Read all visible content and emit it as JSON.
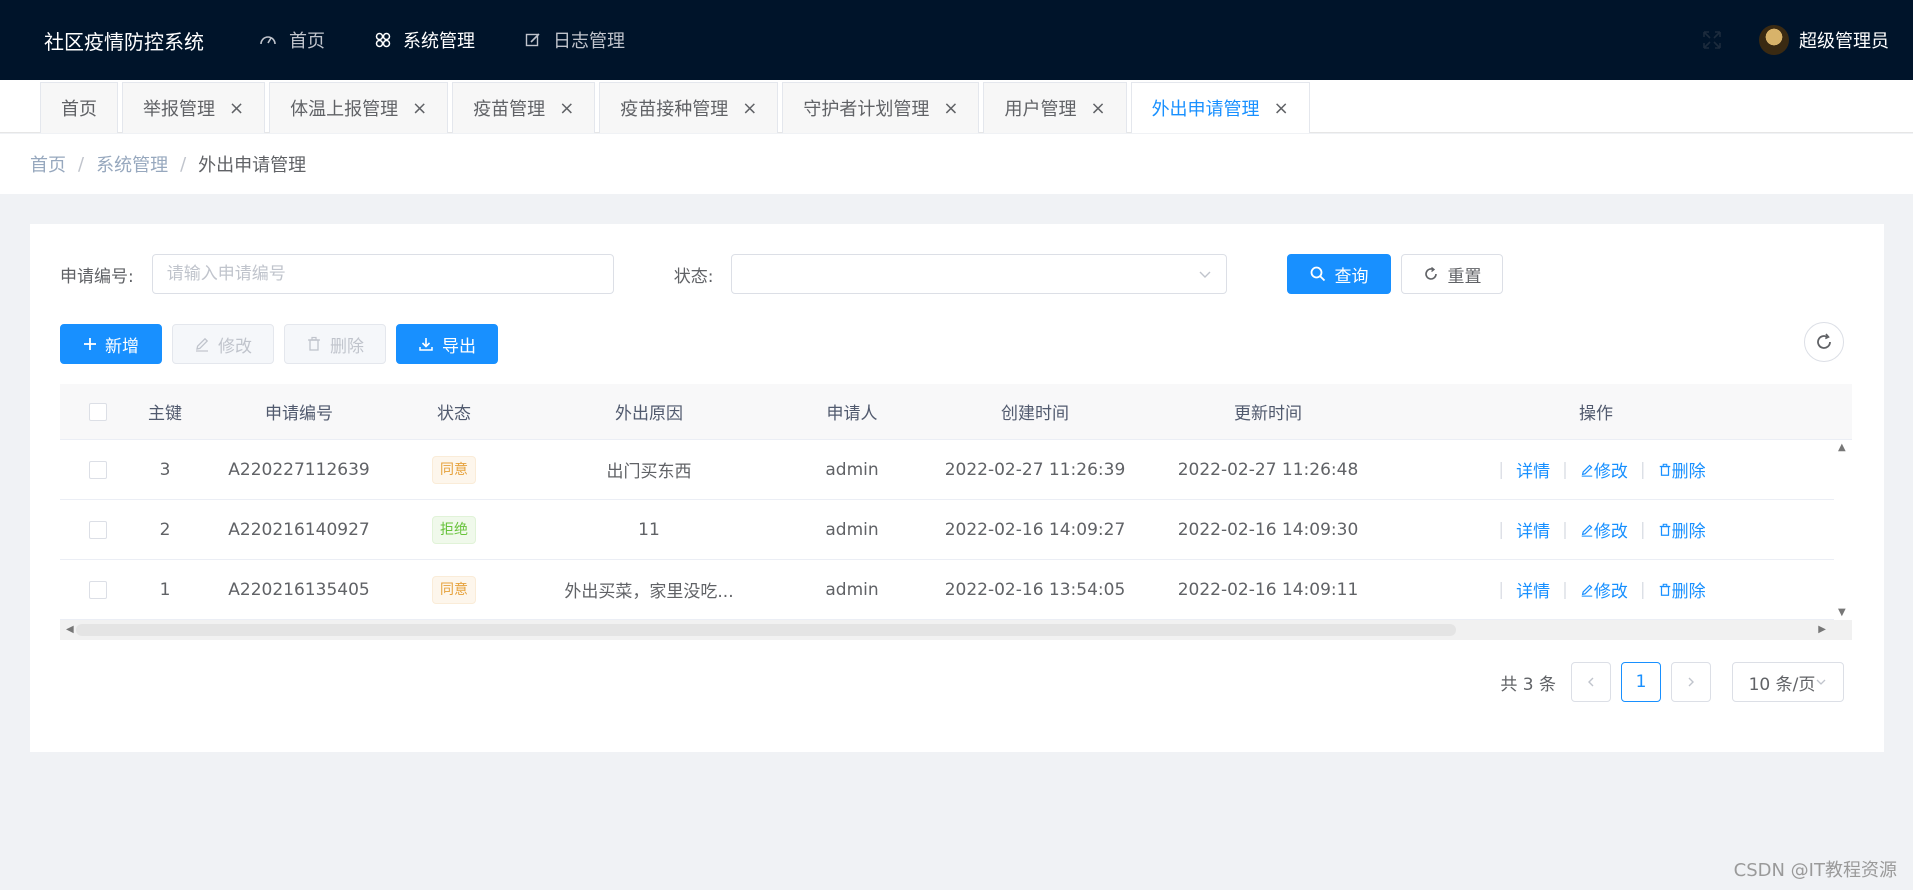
{
  "header": {
    "brand": "社区疫情防控系统",
    "nav": [
      {
        "label": "首页",
        "icon": "dashboard-icon"
      },
      {
        "label": "系统管理",
        "icon": "system-icon"
      },
      {
        "label": "日志管理",
        "icon": "edit-log-icon"
      }
    ],
    "username": "超级管理员"
  },
  "tabs": [
    {
      "label": "首页",
      "closable": false
    },
    {
      "label": "举报管理",
      "closable": true
    },
    {
      "label": "体温上报管理",
      "closable": true
    },
    {
      "label": "疫苗管理",
      "closable": true
    },
    {
      "label": "疫苗接种管理",
      "closable": true
    },
    {
      "label": "守护者计划管理",
      "closable": true
    },
    {
      "label": "用户管理",
      "closable": true
    },
    {
      "label": "外出申请管理",
      "closable": true,
      "active": true
    }
  ],
  "breadcrumb": [
    "首页",
    "系统管理",
    "外出申请管理"
  ],
  "filter": {
    "no_label": "申请编号:",
    "no_placeholder": "请输入申请编号",
    "status_label": "状态:",
    "query": "查询",
    "reset": "重置"
  },
  "toolbar": {
    "add": "新增",
    "edit": "修改",
    "delete": "删除",
    "export": "导出"
  },
  "table": {
    "columns": [
      "主键",
      "申请编号",
      "状态",
      "外出原因",
      "申请人",
      "创建时间",
      "更新时间",
      "操作"
    ],
    "rows": [
      {
        "id": "3",
        "no": "A220227112639",
        "status": "同意",
        "status_type": "warning",
        "reason": "出门买东西",
        "user": "admin",
        "created": "2022-02-27 11:26:39",
        "updated": "2022-02-27 11:26:48"
      },
      {
        "id": "2",
        "no": "A220216140927",
        "status": "拒绝",
        "status_type": "success",
        "reason": "11",
        "user": "admin",
        "created": "2022-02-16 14:09:27",
        "updated": "2022-02-16 14:09:30"
      },
      {
        "id": "1",
        "no": "A220216135405",
        "status": "同意",
        "status_type": "warning",
        "reason": "外出买菜，家里没吃...",
        "user": "admin",
        "created": "2022-02-16 13:54:05",
        "updated": "2022-02-16 14:09:11"
      }
    ],
    "ops": {
      "detail": "详情",
      "edit": "修改",
      "delete": "删除"
    }
  },
  "pagination": {
    "total": "共 3 条",
    "current": "1",
    "page_size": "10 条/页"
  },
  "colors": {
    "primary": "#1890ff",
    "header_bg": "#00142a",
    "tag_warning": "#e6a23c",
    "tag_success": "#67c23a"
  },
  "watermark": "CSDN @IT教程资源"
}
